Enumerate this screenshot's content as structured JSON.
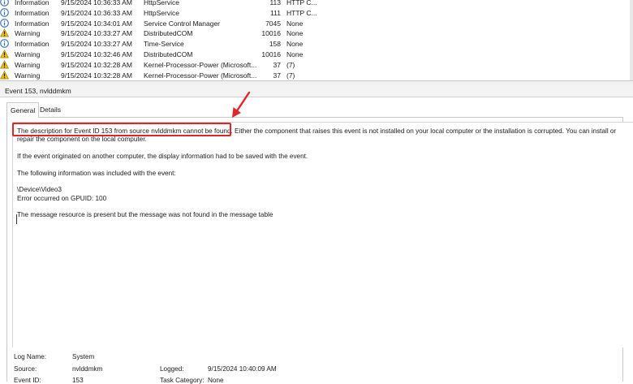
{
  "events": [
    {
      "icon": "information-icon",
      "level": "Information",
      "date": "9/15/2024 10:36:33 AM",
      "source": "HttpService",
      "id": "113",
      "task": "HTTP C..."
    },
    {
      "icon": "information-icon",
      "level": "Information",
      "date": "9/15/2024 10:36:33 AM",
      "source": "HttpService",
      "id": "111",
      "task": "HTTP C..."
    },
    {
      "icon": "information-icon",
      "level": "Information",
      "date": "9/15/2024 10:34:01 AM",
      "source": "Service Control Manager",
      "id": "7045",
      "task": "None"
    },
    {
      "icon": "warning-icon",
      "level": "Warning",
      "date": "9/15/2024 10:33:27 AM",
      "source": "DistributedCOM",
      "id": "10016",
      "task": "None"
    },
    {
      "icon": "information-icon",
      "level": "Information",
      "date": "9/15/2024 10:33:27 AM",
      "source": "Time-Service",
      "id": "158",
      "task": "None"
    },
    {
      "icon": "warning-icon",
      "level": "Warning",
      "date": "9/15/2024 10:32:46 AM",
      "source": "DistributedCOM",
      "id": "10016",
      "task": "None"
    },
    {
      "icon": "warning-icon",
      "level": "Warning",
      "date": "9/15/2024 10:32:28 AM",
      "source": "Kernel-Processor-Power (Microsoft...",
      "id": "37",
      "task": "(7)"
    },
    {
      "icon": "warning-icon",
      "level": "Warning",
      "date": "9/15/2024 10:32:28 AM",
      "source": "Kernel-Processor-Power (Microsoft...",
      "id": "37",
      "task": "(7)"
    }
  ],
  "detail": {
    "title": "Event 153, nvlddmkm",
    "tabs": {
      "general": "General",
      "details": "Details"
    },
    "description": {
      "highlighted": "The description for Event ID 153 from source nvlddmkm cannot be found.",
      "rest": " Either the component that raises this event is not installed on your local computer or the installation is corrupted. You can install or repair the component on the local computer.",
      "p2": "If the event originated on another computer, the display information had to be saved with the event.",
      "p3": "The following information was included with the event:",
      "p4a": "\\Device\\Video3",
      "p4b": "Error occurred on GPUID: 100",
      "p5": "The message resource is present but the message was not found in the message table"
    },
    "props": {
      "log_name_label": "Log Name:",
      "log_name_value": "System",
      "source_label": "Source:",
      "source_value": "nvlddmkm",
      "logged_label": "Logged:",
      "logged_value": "9/15/2024 10:40:09 AM",
      "event_id_label": "Event ID:",
      "event_id_value": "153",
      "task_category_label": "Task Category:",
      "task_category_value": "None"
    }
  },
  "colors": {
    "highlight": "#e0262b",
    "info_icon": "#3b6fb6",
    "warning_icon": "#f2c200"
  }
}
